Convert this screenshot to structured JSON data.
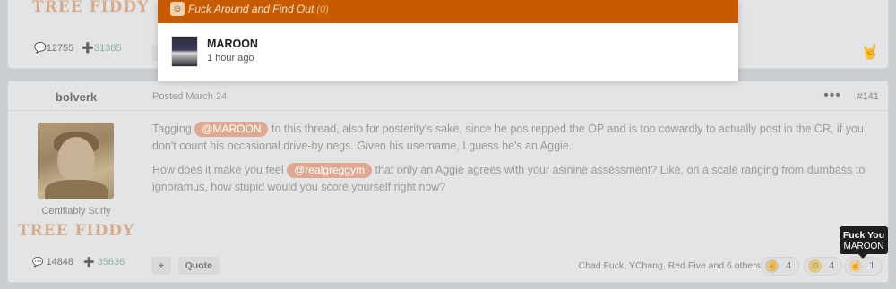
{
  "top_post": {
    "rank_badge": "TREE FIDDY",
    "comment_count": "12755",
    "reputation": "31385"
  },
  "popover": {
    "reaction_title": "Fuck Around and Find Out",
    "reaction_count": "(0)",
    "user_name": "MAROON",
    "time_ago": "1 hour ago",
    "header_color": "#c85a00"
  },
  "post": {
    "author": "bolverk",
    "posted": "Posted March 24",
    "number": "#141",
    "user_title": "Certifiably Surly",
    "rank_badge": "TREE FIDDY",
    "comment_count": "14848",
    "reputation": "35636",
    "paragraph1": {
      "before": "Tagging",
      "mention": "@MAROON",
      "after": "to this thread, also for posterity's sake, since he pos repped the OP and is too cowardly to actually post in the CR, if you don't count his occasional drive-by negs. Given his username, I guess he's an Aggie."
    },
    "paragraph2": {
      "before": "How does it make you feel",
      "mention": "@realgreggym",
      "after": "that only an Aggie agrees with your asinine assessment? Like, on a scale ranging from dumbass to ignoramus, how stupid would you score yourself right now?"
    },
    "actions": {
      "plus": "+",
      "quote": "Quote"
    },
    "reactors": "Chad Fuck, YChang, Red Five and 6 others",
    "reactions": [
      {
        "icon": "horns-hand-icon",
        "count": "4"
      },
      {
        "icon": "laughing-face-icon",
        "count": "4"
      },
      {
        "icon": "middle-finger-icon",
        "count": "1"
      }
    ]
  },
  "tooltip": {
    "title": "Fuck You",
    "user": "MAROON"
  }
}
